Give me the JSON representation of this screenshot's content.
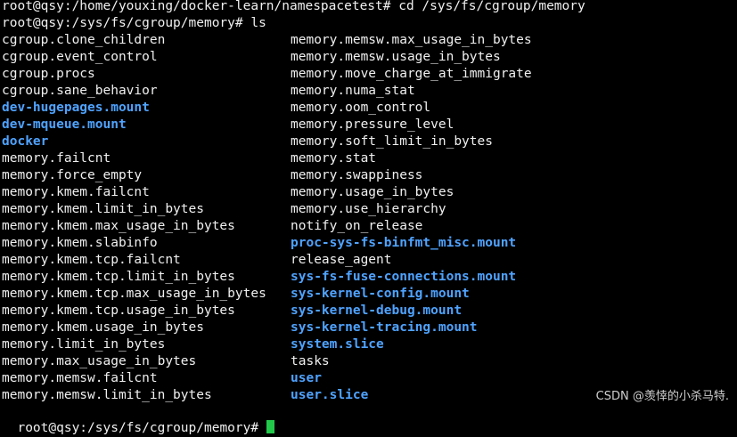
{
  "terminal": {
    "line1": "root@qsy:/home/youxing/docker-learn/namespacetest# cd /sys/fs/cgroup/memory",
    "line2": "root@qsy:/sys/fs/cgroup/memory# ls",
    "last_prompt": "root@qsy:/sys/fs/cgroup/memory# ",
    "colors": {
      "background": "#000000",
      "text": "#f0f0f0",
      "directory": "#4fa3ff",
      "cursor": "#22c84a"
    }
  },
  "ls": {
    "left": [
      {
        "name": "cgroup.clone_children",
        "dir": false
      },
      {
        "name": "cgroup.event_control",
        "dir": false
      },
      {
        "name": "cgroup.procs",
        "dir": false
      },
      {
        "name": "cgroup.sane_behavior",
        "dir": false
      },
      {
        "name": "dev-hugepages.mount",
        "dir": true
      },
      {
        "name": "dev-mqueue.mount",
        "dir": true
      },
      {
        "name": "docker",
        "dir": true
      },
      {
        "name": "memory.failcnt",
        "dir": false
      },
      {
        "name": "memory.force_empty",
        "dir": false
      },
      {
        "name": "memory.kmem.failcnt",
        "dir": false
      },
      {
        "name": "memory.kmem.limit_in_bytes",
        "dir": false
      },
      {
        "name": "memory.kmem.max_usage_in_bytes",
        "dir": false
      },
      {
        "name": "memory.kmem.slabinfo",
        "dir": false
      },
      {
        "name": "memory.kmem.tcp.failcnt",
        "dir": false
      },
      {
        "name": "memory.kmem.tcp.limit_in_bytes",
        "dir": false
      },
      {
        "name": "memory.kmem.tcp.max_usage_in_bytes",
        "dir": false
      },
      {
        "name": "memory.kmem.tcp.usage_in_bytes",
        "dir": false
      },
      {
        "name": "memory.kmem.usage_in_bytes",
        "dir": false
      },
      {
        "name": "memory.limit_in_bytes",
        "dir": false
      },
      {
        "name": "memory.max_usage_in_bytes",
        "dir": false
      },
      {
        "name": "memory.memsw.failcnt",
        "dir": false
      },
      {
        "name": "memory.memsw.limit_in_bytes",
        "dir": false
      }
    ],
    "right": [
      {
        "name": "memory.memsw.max_usage_in_bytes",
        "dir": false
      },
      {
        "name": "memory.memsw.usage_in_bytes",
        "dir": false
      },
      {
        "name": "memory.move_charge_at_immigrate",
        "dir": false
      },
      {
        "name": "memory.numa_stat",
        "dir": false
      },
      {
        "name": "memory.oom_control",
        "dir": false
      },
      {
        "name": "memory.pressure_level",
        "dir": false
      },
      {
        "name": "memory.soft_limit_in_bytes",
        "dir": false
      },
      {
        "name": "memory.stat",
        "dir": false
      },
      {
        "name": "memory.swappiness",
        "dir": false
      },
      {
        "name": "memory.usage_in_bytes",
        "dir": false
      },
      {
        "name": "memory.use_hierarchy",
        "dir": false
      },
      {
        "name": "notify_on_release",
        "dir": false
      },
      {
        "name": "proc-sys-fs-binfmt_misc.mount",
        "dir": true
      },
      {
        "name": "release_agent",
        "dir": false
      },
      {
        "name": "sys-fs-fuse-connections.mount",
        "dir": true
      },
      {
        "name": "sys-kernel-config.mount",
        "dir": true
      },
      {
        "name": "sys-kernel-debug.mount",
        "dir": true
      },
      {
        "name": "sys-kernel-tracing.mount",
        "dir": true
      },
      {
        "name": "system.slice",
        "dir": true
      },
      {
        "name": "tasks",
        "dir": false
      },
      {
        "name": "user",
        "dir": true
      },
      {
        "name": "user.slice",
        "dir": true
      }
    ]
  },
  "watermark": "CSDN @羡悻的小杀马特."
}
